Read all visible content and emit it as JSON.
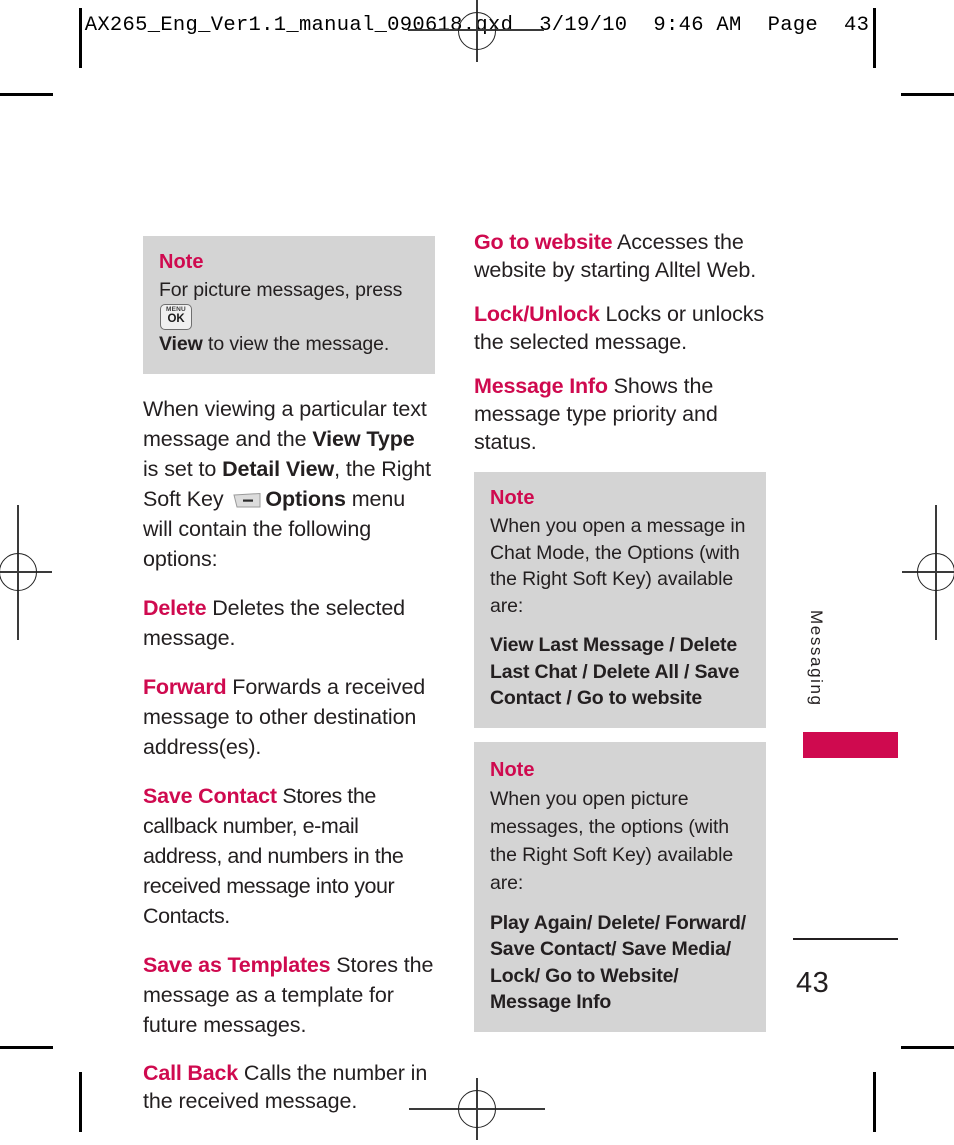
{
  "print_header": {
    "filename": "AX265_Eng_Ver1.1_manual_090618.qxd",
    "date": "3/19/10",
    "time": "9:46 AM",
    "page_word": "Page",
    "page_number": "43"
  },
  "colors": {
    "accent_magenta": "#cf0a4f",
    "note_background": "#d4d4d4",
    "body_text": "#231f20"
  },
  "left_column": {
    "note": {
      "title": "Note",
      "text_before_key": "For picture messages, press",
      "key_icon_top": "MENU",
      "key_icon_bottom": "OK",
      "text_bold_after_key": "View",
      "text_after_key": " to view the message."
    },
    "intro": {
      "part1": "When viewing a particular text message and the ",
      "bold1": "View Type",
      "part2": " is set to ",
      "bold2": "Detail View",
      "part3": ", the Right Soft Key ",
      "bold3": "Options",
      "part4": " menu will contain the following options:"
    },
    "options": [
      {
        "term": "Delete",
        "description": " Deletes the selected message."
      },
      {
        "term": "Forward",
        "description": " Forwards a received message to other destination address(es)."
      },
      {
        "term": "Save Contact",
        "description": " Stores the callback number, e-mail address, and numbers in the received message into your Contacts."
      },
      {
        "term": "Save as Templates",
        "description": " Stores the message as a template for future messages."
      },
      {
        "term": "Call Back",
        "description": " Calls the number in the received message."
      }
    ]
  },
  "right_column": {
    "options": [
      {
        "term": "Go to website",
        "description": "  Accesses the website by starting Alltel Web."
      },
      {
        "term": "Lock/Unlock",
        "description": " Locks or unlocks the selected message."
      },
      {
        "term": "Message Info",
        "description": " Shows the message type priority and status."
      }
    ],
    "notes": [
      {
        "title": "Note",
        "body": "When you open a message in Chat Mode, the Options (with the Right Soft Key) available are:",
        "list": "View Last Message / Delete Last Chat / Delete All / Save Contact / Go to website"
      },
      {
        "title": "Note",
        "body": "When you open picture messages, the options (with the Right Soft Key) available are:",
        "list": "Play Again/ Delete/ Forward/ Save Contact/ Save Media/ Lock/ Go to Website/ Message Info"
      }
    ]
  },
  "side_tab": {
    "label": "Messaging"
  },
  "folio": {
    "page_number": "43"
  }
}
